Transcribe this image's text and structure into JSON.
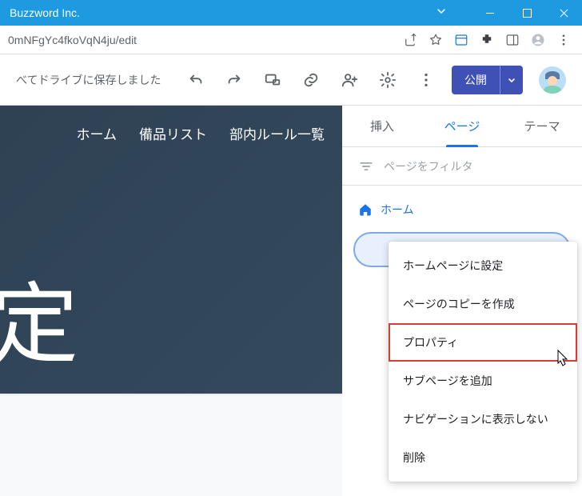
{
  "window": {
    "title": "Buzzword Inc."
  },
  "address": {
    "url_fragment": "0mNFgYc4fkoVqN4ju/edit"
  },
  "toolbar": {
    "save_message": "べてドライブに保存しました",
    "publish_label": "公開"
  },
  "canvas": {
    "nav": [
      "ホーム",
      "備品リスト",
      "部内ルール一覧"
    ],
    "big_char": "定"
  },
  "panel": {
    "tabs": {
      "insert": "挿入",
      "pages": "ページ",
      "theme": "テーマ"
    },
    "filter_placeholder": "ページをフィルタ",
    "home_label": "ホーム"
  },
  "context_menu": {
    "items": [
      "ホームページに設定",
      "ページのコピーを作成",
      "プロパティ",
      "サブページを追加",
      "ナビゲーションに表示しない",
      "削除"
    ]
  }
}
